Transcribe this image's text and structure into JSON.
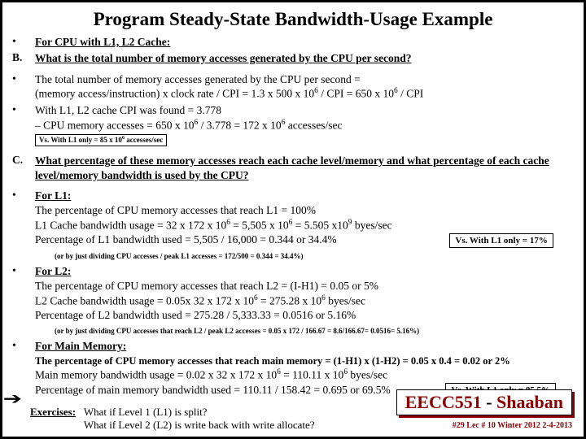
{
  "title": "Program Steady-State Bandwidth-Usage Example",
  "sections": {
    "dot0": "•",
    "B_label": "B.",
    "B": {
      "l1": "For CPU with  L1, L2 Cache:",
      "l2": "What is the total number of memory accesses generated by the CPU per second?"
    },
    "dot1": "•",
    "calc": {
      "l1": "The total number of memory accesses generated by the CPU per second  =",
      "l2a": "(memory access/instruction)  x clock rate / CPI  =  1.3 x 500 x 10",
      "l2b": " / CPI =  650 x 10",
      "l2c": " / CPI",
      "l3": "With  L1, L2 cache CPI was found = 3.778",
      "l4a": "–       CPU memory accesses  = 650 x 10",
      "l4b": " / 3.778   =   172  x   10",
      "l4c": "  accesses/sec",
      "note1a": "Vs.  With L1 only = 85  x  10",
      "note1b": "  accesses/sec"
    },
    "dot2": "•",
    "C_label": "C.",
    "C": "What percentage of these memory accesses reach each cache level/memory and what percentage of each cache level/memory bandwidth is used by the CPU?",
    "dot3": "•",
    "L1": {
      "heading": "For L1:",
      "l1": "The percentage of CPU memory accesses that reach L1 = 100%",
      "l2a": "L1 Cache bandwidth usage =  32 x 172 x  10",
      "l2b": " =  5,505 x 10",
      "l2c": " = 5.505 x10",
      "l2d": " byes/sec",
      "l3": "Percentage of L1 bandwidth used = 5,505 / 16,000 = 0.344 or  34.4%",
      "box": "Vs.  With L1 only = 17%",
      "small": "(or   by just dividing   CPU accesses / peak L1 accesses  =  172/500  =  0.344 = 34.4%)"
    },
    "dot4": "•",
    "L2": {
      "heading": "For L2:",
      "l1": "The percentage of CPU memory accesses that reach L2 = (I-H1) = 0.05 or  5%",
      "l2a": "L2 Cache bandwidth usage =  0.05x 32 x 172 x  10",
      "l2b": " =  275.28 x 10",
      "l2c": "  byes/sec",
      "l3": "Percentage of L2 bandwidth used = 275.28 / 5,333.33 = 0.0516 or  5.16%",
      "small": "(or   by just dividing   CPU accesses that reach L2 / peak L2 accesses  =  0.05 x 172 / 166.67 = 8.6/166.67=  0.0516= 5.16%)"
    },
    "dot5": "•",
    "MM": {
      "heading": "For Main Memory:",
      "l1": "The percentage of CPU memory accesses that reach main memory =  (1-H1) x (1-H2) = 0.05 x 0.4 =  0.02 or  2%",
      "l2a": "Main memory bandwidth usage =  0.02 x 32 x 172 x  10",
      "l2b": " =  110.11 x 10",
      "l2c": " byes/sec",
      "l3": "Percentage of main memory bandwidth used = 110.11 / 158.42 = 0.695 or  69.5%",
      "box": "Vs.  With L1 only = 85.5%"
    },
    "exercises": {
      "label": "Exercises:",
      "l1": "What if Level 1 (L1) is split?",
      "l2": "What if Level 2 (L2) is write back with write allocate?"
    }
  },
  "brand": {
    "left": "EECC551",
    "right": "Shaaban",
    "lec": "#29   Lec # 10 Winter 2012  2-4-2013"
  },
  "exp6": "6",
  "exp9": "9"
}
